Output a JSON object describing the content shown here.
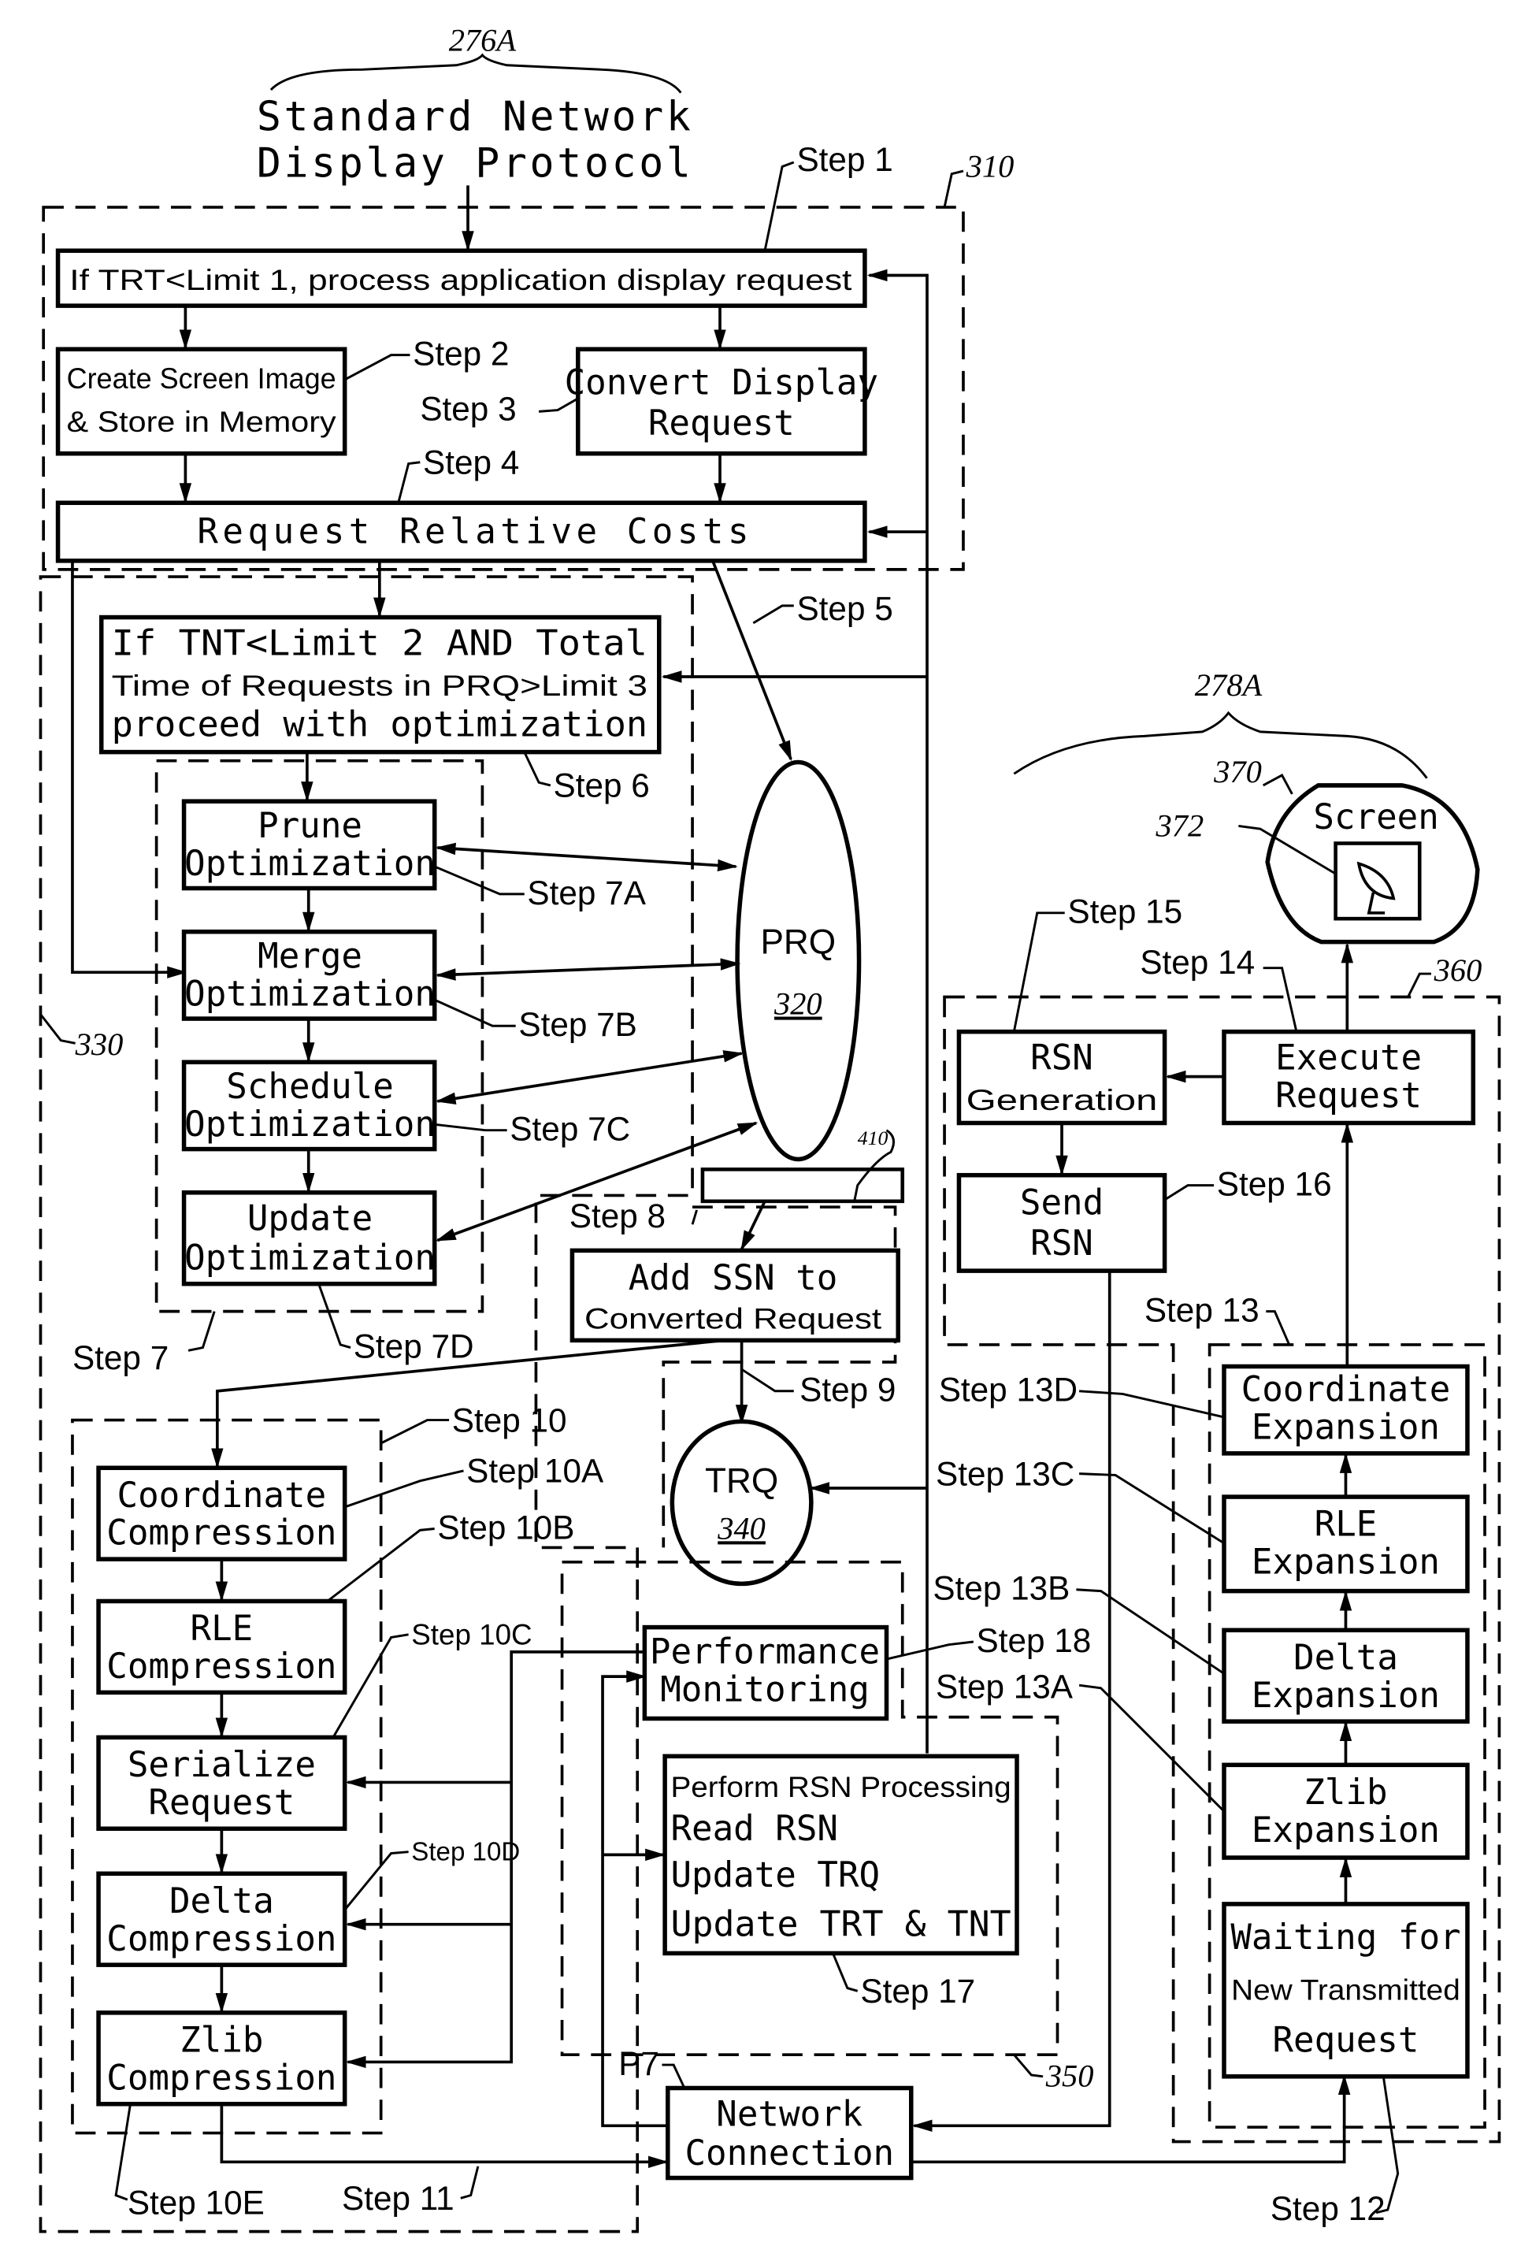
{
  "diagram": {
    "client_ref": "276A",
    "client_title_line1": "Standard Network",
    "client_title_line2": "Display Protocol",
    "server_ref": "278A",
    "refs": {
      "r310": "310",
      "r330": "330",
      "r350": "350",
      "r360": "360",
      "r370": "370",
      "r372": "372",
      "r410": "410",
      "p7": "P7"
    },
    "boxes": {
      "step1": "If TRT<Limit 1, process application display request",
      "create_l1": "Create Screen Image",
      "create_l2": "& Store in Memory",
      "convert_l1": "Convert Display",
      "convert_l2": "Request",
      "relative_costs": "Request Relative Costs",
      "tnt_l1": "If TNT<Limit 2 AND Total",
      "tnt_l2": "Time of Requests in PRQ>Limit 3",
      "tnt_l3": "proceed with optimization",
      "prune_l1": "Prune",
      "prune_l2": "Optimization",
      "merge_l1": "Merge",
      "merge_l2": "Optimization",
      "schedule_l1": "Schedule",
      "schedule_l2": "Optimization",
      "update_l1": "Update",
      "update_l2": "Optimization",
      "prq_l1": "PRQ",
      "prq_l2": "320",
      "addssn_l1": "Add SSN to",
      "addssn_l2": "Converted Request",
      "trq_l1": "TRQ",
      "trq_l2": "340",
      "coordc_l1": "Coordinate",
      "coordc_l2": "Compression",
      "rlec_l1": "RLE",
      "rlec_l2": "Compression",
      "serial_l1": "Serialize",
      "serial_l2": "Request",
      "deltac_l1": "Delta",
      "deltac_l2": "Compression",
      "zlibc_l1": "Zlib",
      "zlibc_l2": "Compression",
      "perf_l1": "Performance",
      "perf_l2": "Monitoring",
      "rsnp_l1": "Perform RSN Processing",
      "rsnp_l2": "Read RSN",
      "rsnp_l3": "Update TRQ",
      "rsnp_l4": "Update TRT & TNT",
      "net_l1": "Network",
      "net_l2": "Connection",
      "screen": "Screen",
      "rsngen_l1": "RSN",
      "rsngen_l2": "Generation",
      "exec_l1": "Execute",
      "exec_l2": "Request",
      "sendrsn_l1": "Send",
      "sendrsn_l2": "RSN",
      "coorde_l1": "Coordinate",
      "coorde_l2": "Expansion",
      "rlee_l1": "RLE",
      "rlee_l2": "Expansion",
      "deltae_l1": "Delta",
      "deltae_l2": "Expansion",
      "zlibe_l1": "Zlib",
      "zlibe_l2": "Expansion",
      "wait_l1": "Waiting for",
      "wait_l2": "New Transmitted",
      "wait_l3": "Request"
    },
    "steps": {
      "s1": "Step 1",
      "s2": "Step 2",
      "s3": "Step 3",
      "s4": "Step 4",
      "s5": "Step 5",
      "s6": "Step 6",
      "s7": "Step 7",
      "s7a": "Step 7A",
      "s7b": "Step 7B",
      "s7c": "Step 7C",
      "s7d": "Step 7D",
      "s8": "Step 8",
      "s9": "Step 9",
      "s10": "Step 10",
      "s10a": "Step 10A",
      "s10b": "Step 10B",
      "s10c": "Step 10C",
      "s10d": "Step 10D",
      "s10e": "Step 10E",
      "s11": "Step 11",
      "s12": "Step 12",
      "s13": "Step 13",
      "s13a": "Step 13A",
      "s13b": "Step 13B",
      "s13c": "Step 13C",
      "s13d": "Step 13D",
      "s14": "Step 14",
      "s15": "Step 15",
      "s16": "Step 16",
      "s17": "Step 17",
      "s18": "Step 18"
    }
  }
}
